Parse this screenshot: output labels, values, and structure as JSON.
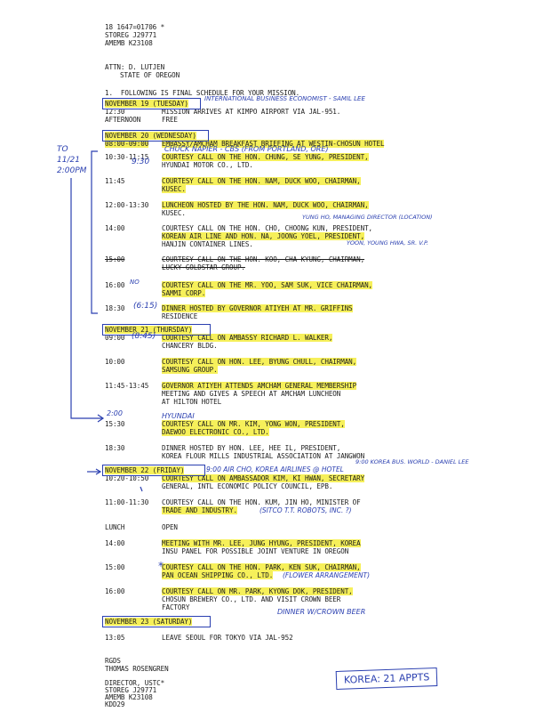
{
  "header": {
    "line1": "18 1647=01706 *",
    "line2": "STOREG J29771",
    "line3": "AMEMB K23108"
  },
  "attn": {
    "line1": "ATTN: D. LUTJEN",
    "line2": "STATE OF OREGON"
  },
  "intro": "1.  FOLLOWING IS FINAL SCHEDULE FOR YOUR MISSION.",
  "days": [
    {
      "date": "NOVEMBER 19 (TUESDAY)",
      "entries": [
        {
          "time": "12:30",
          "text": [
            "MISSION ARRIVES AT KIMPO AIRPORT VIA JAL-951."
          ]
        },
        {
          "time": "AFTERNOON",
          "text": [
            "FREE"
          ]
        }
      ]
    },
    {
      "date": "NOVEMBER 20 (WEDNESDAY)",
      "entries": [
        {
          "time": "08:00-09:00",
          "text": [
            "EMBASSY/AMCHAM BREAKFAST BRIEFING AT WESTIN-CHOSUN HOTEL"
          ]
        },
        {
          "time": "10:30-11:15",
          "text": [
            "COURTESY CALL ON THE HON. CHUNG, SE YUNG, PRESIDENT,",
            "HYUNDAI MOTOR CO., LTD."
          ]
        },
        {
          "time": "11:45",
          "text": [
            "COURTESY CALL ON THE HON. NAM, DUCK WOO, CHAIRMAN,",
            "KUSEC."
          ]
        },
        {
          "time": "12:00-13:30",
          "text": [
            "LUNCHEON HOSTED BY THE HON. NAM, DUCK WOO, CHAIRMAN,",
            "KUSEC."
          ]
        },
        {
          "time": "14:00",
          "text": [
            "COURTESY CALL ON THE HON. CHO, CHOONG KUN, PRESIDENT,",
            "KOREAN AIR LINE AND HON. NA, JOONG YOEL, PRESIDENT,",
            "HANJIN CONTAINER LINES."
          ]
        },
        {
          "time": "15:00",
          "text": [
            "COURTESY CALL ON THE HON. KOO, CHA KYUNG, CHAIRMAN,",
            "LUCKY-GOLDSTAR GROUP."
          ]
        },
        {
          "time": "16:00",
          "text": [
            "COURTESY CALL ON THE MR. YOO, SAM SUK, VICE CHAIRMAN,",
            "SAMMI CORP."
          ]
        },
        {
          "time": "18:30",
          "text": [
            "DINNER HOSTED BY GOVERNOR ATIYEH AT MR. GRIFFINS",
            "RESIDENCE"
          ]
        }
      ]
    },
    {
      "date": "NOVEMBER 21 (THURSDAY)",
      "entries": [
        {
          "time": "09:00",
          "text": [
            "COURTESY CALL ON AMBASSY RICHARD L. WALKER,",
            "CHANCERY BLDG."
          ]
        },
        {
          "time": "10:00",
          "text": [
            "COURTESY CALL ON HON. LEE, BYUNG CHULL, CHAIRMAN,",
            "SAMSUNG GROUP."
          ]
        },
        {
          "time": "11:45-13:45",
          "text": [
            "GOVERNOR ATIYEH ATTENDS AMCHAM GENERAL MEMBERSHIP",
            "MEETING AND GIVES A SPEECH AT AMCHAM LUNCHEON",
            "AT HILTON HOTEL"
          ]
        },
        {
          "time": "15:30",
          "text": [
            "COURTESY CALL ON MR. KIM, YONG WON, PRESIDENT,",
            "DAEWOO ELECTRONIC CO., LTD."
          ]
        },
        {
          "time": "18:30",
          "text": [
            "DINNER HOSTED BY HON. LEE, HEE IL, PRESIDENT,",
            "KOREA FLOUR MILLS INDUSTRIAL ASSOCIATION AT JANGWON"
          ]
        }
      ]
    },
    {
      "date": "NOVEMBER 22 (FRIDAY)",
      "entries": [
        {
          "time": "10:20-10:50",
          "text": [
            "COURTESY CALL ON AMBASSADOR KIM, KI HWAN, SECRETARY",
            "GENERAL, INTL ECONOMIC POLICY COUNCIL, EPB."
          ]
        },
        {
          "time": "11:00-11:30",
          "text": [
            "COURTESY CALL ON THE HON. KUM, JIN HO, MINISTER OF",
            "TRADE AND INDUSTRY."
          ]
        },
        {
          "time": "LUNCH",
          "text": [
            "OPEN"
          ]
        },
        {
          "time": "14:00",
          "text": [
            "MEETING WITH MR. LEE, JUNG HYUNG, PRESIDENT, KOREA",
            "INSU PANEL FOR POSSIBLE JOINT VENTURE IN OREGON"
          ]
        },
        {
          "time": "15:00",
          "text": [
            "COURTESY CALL ON THE HON. PARK, KEN SUK, CHAIRMAN,",
            "PAN OCEAN SHIPPING CO., LTD."
          ]
        },
        {
          "time": "16:00",
          "text": [
            "COURTESY CALL ON MR. PARK, KYONG DOK, PRESIDENT,",
            "CHOSUN BREWERY CO., LTD. AND VISIT CROWN BEER",
            "FACTORY"
          ]
        }
      ]
    },
    {
      "date": "NOVEMBER 23 (SATURDAY)",
      "entries": [
        {
          "time": "13:05",
          "text": [
            "LEAVE SEOUL FOR TOKYO VIA JAL-952"
          ]
        }
      ]
    }
  ],
  "signoff": {
    "line1": "RGDS",
    "line2": "THOMAS ROSENGREN"
  },
  "footer": {
    "line1": "DIRECTOR, USTC*",
    "line2": "STOREG J29771",
    "line3": "AMEMB K23108",
    "line4": "KDD29"
  },
  "handwritten": {
    "n19": "INTERNATIONAL BUSINESS ECONOMIST - SAMIL LEE",
    "n20a": "9:30",
    "n20b": "CHUCK NAPIER - CBS (FROM PORTLAND, ORE)",
    "to_note": "TO\n11/21\n2:00PM",
    "n20c": "YUNG HO, MANAGING DIRECTOR (LOCATION)",
    "n20d": "YOON, YOUNG HWA, SR. V.P.",
    "n1600": "NO",
    "n1830": "(6:15)",
    "n0900": "(8:45)",
    "n200": "2:00",
    "hyundai": "HYUNDAI",
    "n22": "9:00  AIR CHO, KOREA AIRLINES @ HOTEL",
    "n22b": "9:00  KOREA BUS. WORLD - DANIEL LEE",
    "sitco": "(SITCO T.T. ROBOTS, INC. ?)",
    "flower": "(FLOWER ARRANGEMENT)",
    "dinner": "DINNER W/CROWN BEER",
    "stamp": "KOREA: 21 APPTS"
  }
}
